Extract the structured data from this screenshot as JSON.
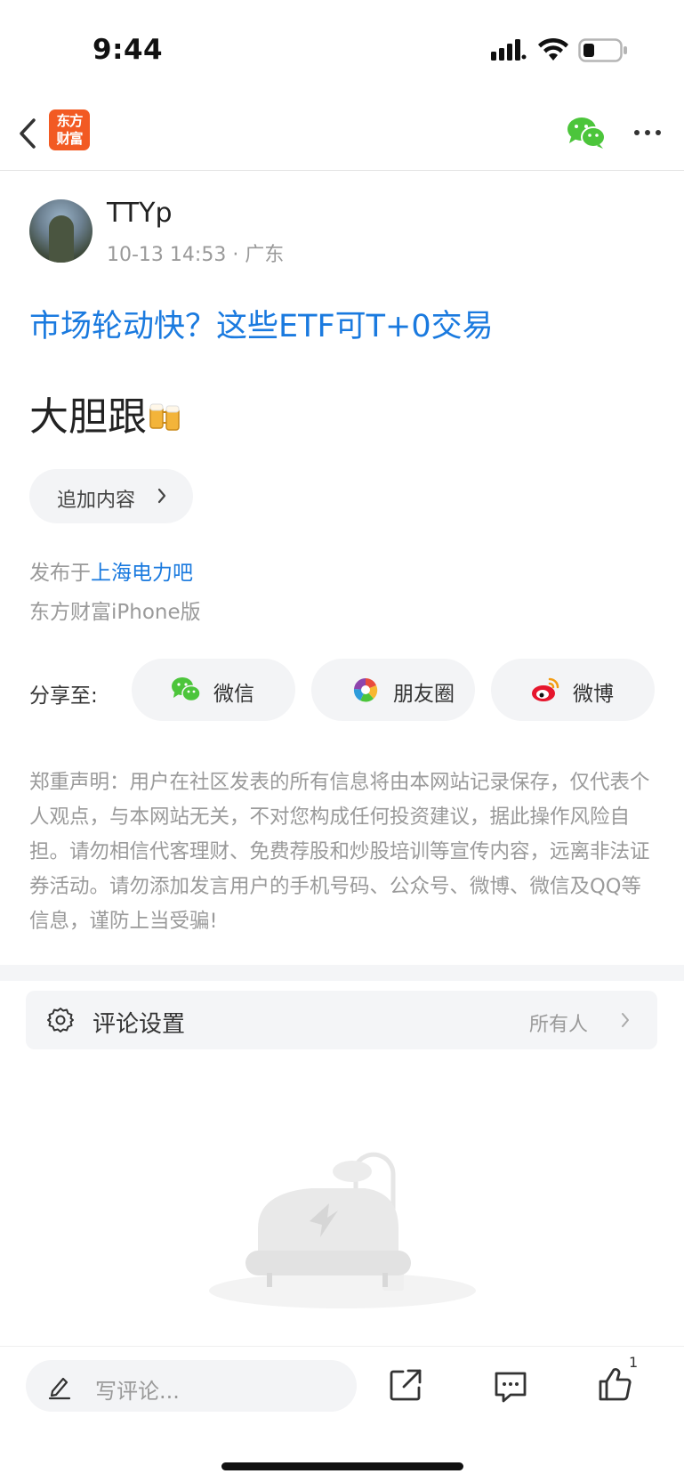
{
  "status_bar": {
    "time": "9:44"
  },
  "nav": {
    "app_logo_line1": "东方",
    "app_logo_line2": "财富"
  },
  "author": {
    "name": "TTYp",
    "meta": "10-13 14:53 · 广东"
  },
  "post": {
    "title": "市场轮动快？这些ETF可T+0交易",
    "body": "大胆跟",
    "append_label": "追加内容",
    "publish_prefix": "发布于",
    "publish_board": "上海电力吧",
    "client": "东方财富iPhone版"
  },
  "share": {
    "label": "分享至:",
    "options": [
      "微信",
      "朋友圈",
      "微博"
    ]
  },
  "disclaimer": "郑重声明：用户在社区发表的所有信息将由本网站记录保存，仅代表个人观点，与本网站无关，不对您构成任何投资建议，据此操作风险自担。请勿相信代客理财、免费荐股和炒股培训等宣传内容，远离非法证券活动。请勿添加发言用户的手机号码、公众号、微博、微信及QQ等信息，谨防上当受骗!",
  "comment_settings": {
    "label": "评论设置",
    "value": "所有人"
  },
  "bottom_bar": {
    "comment_placeholder": "写评论...",
    "like_count": "1"
  },
  "colors": {
    "link_blue": "#1a7adf",
    "logo_orange": "#f25a23",
    "wechat_green": "#2dc100"
  }
}
